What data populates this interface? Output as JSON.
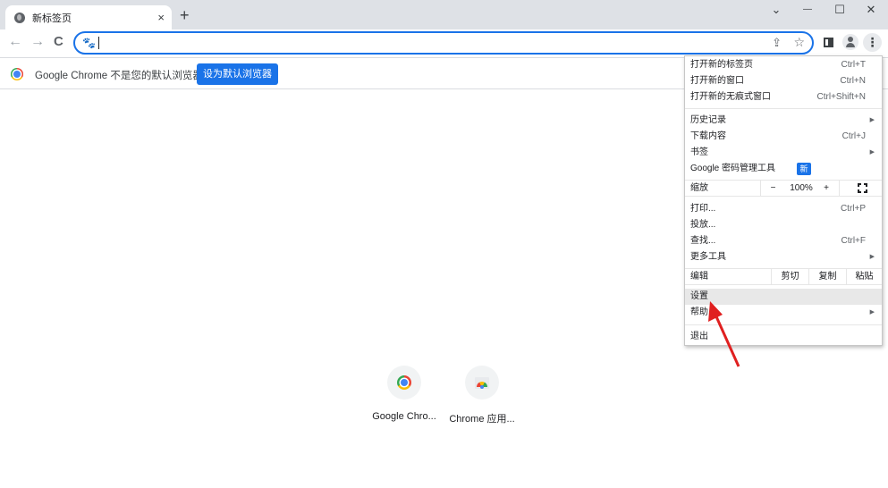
{
  "tab": {
    "title": "新标签页",
    "close_icon": "×",
    "new_tab_icon": "+"
  },
  "window_controls": {
    "dropdown": "⌄",
    "minimize": "—",
    "maximize": "☐",
    "close": "✕"
  },
  "toolbar": {
    "back": "←",
    "forward": "→",
    "reload": "C",
    "omnibox_value": "",
    "search_engine_icon": "🐾",
    "share_icon": "⇪",
    "bookmark_icon": "☆",
    "menu_icon": "⋮"
  },
  "infobar": {
    "message": "Google Chrome 不是您的默认浏览器",
    "button_label": "设为默认浏览器"
  },
  "shortcuts": [
    {
      "label": "Google Chro..."
    },
    {
      "label": "Chrome 应用..."
    }
  ],
  "menu": {
    "items": [
      {
        "label": "打开新的标签页",
        "shortcut": "Ctrl+T"
      },
      {
        "label": "打开新的窗口",
        "shortcut": "Ctrl+N"
      },
      {
        "label": "打开新的无痕式窗口",
        "shortcut": "Ctrl+Shift+N"
      },
      {
        "label": "历史记录",
        "submenu": "▶"
      },
      {
        "label": "下载内容",
        "shortcut": "Ctrl+J"
      },
      {
        "label": "书签",
        "submenu": "▶"
      },
      {
        "label": "Google 密码管理工具",
        "badge": "新"
      },
      {
        "label": "打印...",
        "shortcut": "Ctrl+P"
      },
      {
        "label": "投放..."
      },
      {
        "label": "查找...",
        "shortcut": "Ctrl+F"
      },
      {
        "label": "更多工具",
        "submenu": "▶"
      },
      {
        "label": "设置"
      },
      {
        "label": "帮助",
        "submenu": "▶"
      },
      {
        "label": "退出"
      }
    ],
    "zoom": {
      "label": "缩放",
      "minus": "−",
      "value": "100%",
      "plus": "+"
    },
    "edit": {
      "label": "编辑",
      "cut": "剪切",
      "copy": "复制",
      "paste": "粘贴"
    }
  },
  "annotation": {
    "color": "#e02020"
  }
}
